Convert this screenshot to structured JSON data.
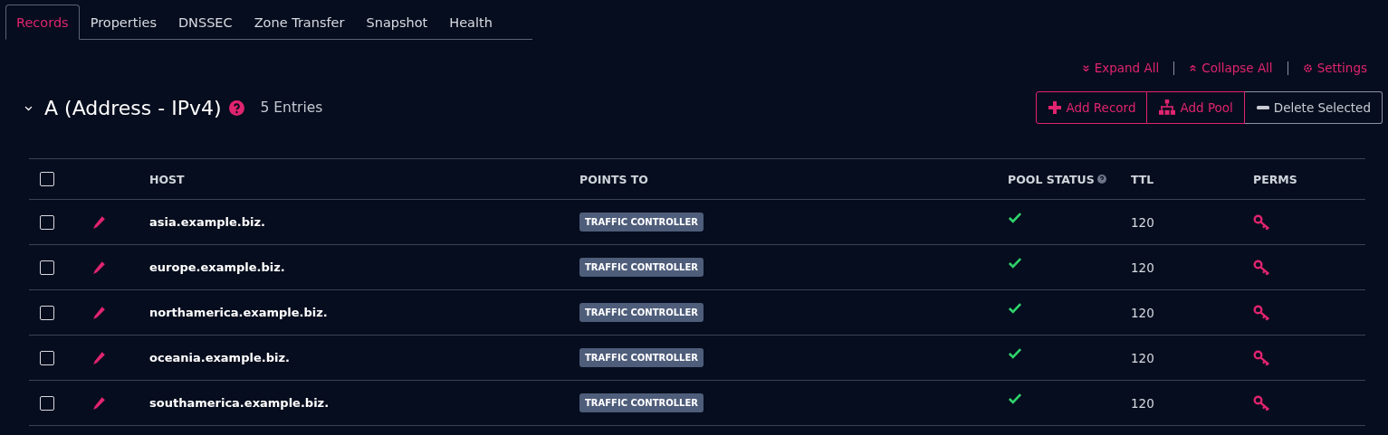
{
  "tabs": [
    {
      "label": "Records",
      "selected": true
    },
    {
      "label": "Properties",
      "selected": false
    },
    {
      "label": "DNSSEC",
      "selected": false
    },
    {
      "label": "Zone Transfer",
      "selected": false
    },
    {
      "label": "Snapshot",
      "selected": false
    },
    {
      "label": "Health",
      "selected": false
    }
  ],
  "links": [
    {
      "kind": "expand",
      "label": "Expand All"
    },
    {
      "kind": "collapse",
      "label": "Collapse All"
    },
    {
      "kind": "settings",
      "label": "Settings"
    }
  ],
  "section": {
    "title": "A (Address - IPv4)",
    "count": "5 Entries",
    "expanded": true
  },
  "actions": [
    {
      "kind": "add",
      "label": "Add Record"
    },
    {
      "kind": "pool",
      "label": "Add Pool"
    },
    {
      "kind": "delete",
      "label": "Delete Selected"
    }
  ],
  "table": {
    "select_all_checked": false,
    "columns": [
      "HOST",
      "POINTS TO",
      "POOL STATUS",
      "TTL",
      "PERMS"
    ],
    "rows": [
      {
        "checked": false,
        "host": "asia.example.biz.",
        "points_to": "TRAFFIC CONTROLLER",
        "pool_ok": true,
        "ttl": "120"
      },
      {
        "checked": false,
        "host": "europe.example.biz.",
        "points_to": "TRAFFIC CONTROLLER",
        "pool_ok": true,
        "ttl": "120"
      },
      {
        "checked": false,
        "host": "northamerica.example.biz.",
        "points_to": "TRAFFIC CONTROLLER",
        "pool_ok": true,
        "ttl": "120"
      },
      {
        "checked": false,
        "host": "oceania.example.biz.",
        "points_to": "TRAFFIC CONTROLLER",
        "pool_ok": true,
        "ttl": "120"
      },
      {
        "checked": false,
        "host": "southamerica.example.biz.",
        "points_to": "TRAFFIC CONTROLLER",
        "pool_ok": true,
        "ttl": "120"
      }
    ]
  }
}
